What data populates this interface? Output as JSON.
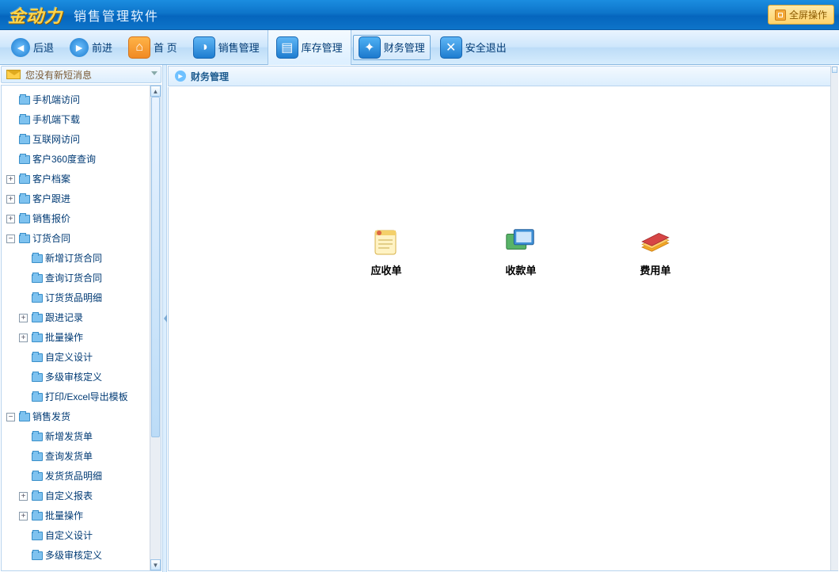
{
  "brand": {
    "logo": "金动力",
    "title": "销售管理软件",
    "fullscreen": "全屏操作"
  },
  "nav": {
    "back": "后退",
    "forward": "前进",
    "home": "首  页",
    "sales": "销售管理",
    "inventory": "库存管理",
    "finance": "财务管理",
    "exit": "安全退出"
  },
  "msgbar": {
    "text": "您没有新短消息"
  },
  "tree": {
    "n0": "手机端访问",
    "n1": "手机端下载",
    "n2": "互联网访问",
    "n3": "客户360度查询",
    "n4": "客户档案",
    "n5": "客户跟进",
    "n6": "销售报价",
    "n7": "订货合同",
    "n7a": "新增订货合同",
    "n7b": "查询订货合同",
    "n7c": "订货货品明细",
    "n7d": "跟进记录",
    "n7e": "批量操作",
    "n7f": "自定义设计",
    "n7g": "多级审核定义",
    "n7h": "打印/Excel导出模板",
    "n8": "销售发货",
    "n8a": "新增发货单",
    "n8b": "查询发货单",
    "n8c": "发货货品明细",
    "n8d": "自定义报表",
    "n8e": "批量操作",
    "n8f": "自定义设计",
    "n8g": "多级审核定义"
  },
  "crumb": {
    "title": "财务管理"
  },
  "cards": {
    "c1": "应收单",
    "c2": "收款单",
    "c3": "费用单"
  }
}
